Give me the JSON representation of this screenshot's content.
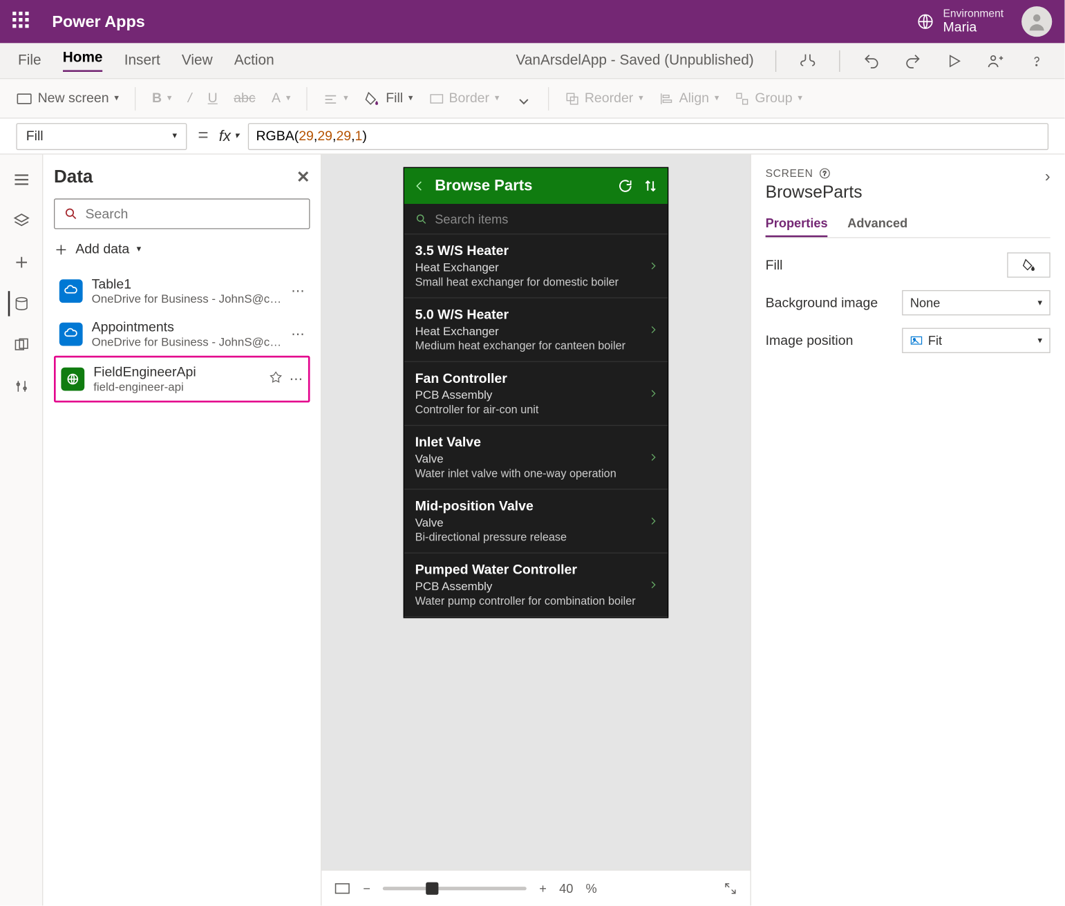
{
  "header": {
    "app_title": "Power Apps",
    "env_label": "Environment",
    "env_name": "Maria"
  },
  "menubar": {
    "items": [
      "File",
      "Home",
      "Insert",
      "View",
      "Action"
    ],
    "active_index": 1,
    "status_text": "VanArsdelApp - Saved (Unpublished)"
  },
  "ribbon": {
    "new_screen": "New screen",
    "fill": "Fill",
    "border": "Border",
    "reorder": "Reorder",
    "align": "Align",
    "group": "Group"
  },
  "formula": {
    "property": "Fill",
    "value_raw": "RGBA(29, 29, 29, 1)",
    "value_parts": [
      {
        "t": "fn",
        "v": "RGBA"
      },
      {
        "t": "op",
        "v": "("
      },
      {
        "t": "num",
        "v": "29"
      },
      {
        "t": "op",
        "v": ","
      },
      {
        "t": "sp",
        "v": " "
      },
      {
        "t": "num",
        "v": "29"
      },
      {
        "t": "op",
        "v": ","
      },
      {
        "t": "sp",
        "v": " "
      },
      {
        "t": "num",
        "v": "29"
      },
      {
        "t": "op",
        "v": ","
      },
      {
        "t": "sp",
        "v": " "
      },
      {
        "t": "num",
        "v": "1"
      },
      {
        "t": "op",
        "v": ")"
      }
    ]
  },
  "datapane": {
    "title": "Data",
    "search_placeholder": "Search",
    "add_data": "Add data",
    "sources": [
      {
        "name": "Table1",
        "sub": "OneDrive for Business - JohnS@conten...",
        "icon": "blue",
        "highlight": false
      },
      {
        "name": "Appointments",
        "sub": "OneDrive for Business - JohnS@conten...",
        "icon": "blue",
        "highlight": false
      },
      {
        "name": "FieldEngineerApi",
        "sub": "field-engineer-api",
        "icon": "green",
        "highlight": true,
        "premium": true
      }
    ]
  },
  "phone": {
    "title": "Browse Parts",
    "search_placeholder": "Search items",
    "parts": [
      {
        "name": "3.5 W/S Heater",
        "cat": "Heat Exchanger",
        "desc": "Small heat exchanger for domestic boiler"
      },
      {
        "name": "5.0 W/S Heater",
        "cat": "Heat Exchanger",
        "desc": "Medium  heat exchanger for canteen boiler"
      },
      {
        "name": "Fan Controller",
        "cat": "PCB Assembly",
        "desc": "Controller for air-con unit"
      },
      {
        "name": "Inlet Valve",
        "cat": "Valve",
        "desc": "Water inlet valve with one-way operation"
      },
      {
        "name": "Mid-position Valve",
        "cat": "Valve",
        "desc": "Bi-directional pressure release"
      },
      {
        "name": "Pumped Water Controller",
        "cat": "PCB Assembly",
        "desc": "Water pump controller for combination boiler"
      }
    ]
  },
  "propspane": {
    "category": "SCREEN",
    "name": "BrowseParts",
    "tabs": [
      "Properties",
      "Advanced"
    ],
    "active_tab": 0,
    "rows": {
      "fill_label": "Fill",
      "bgimage_label": "Background image",
      "bgimage_value": "None",
      "imgpos_label": "Image position",
      "imgpos_value": "Fit"
    }
  },
  "canvas_footer": {
    "zoom_value": "40",
    "zoom_suffix": "%"
  }
}
